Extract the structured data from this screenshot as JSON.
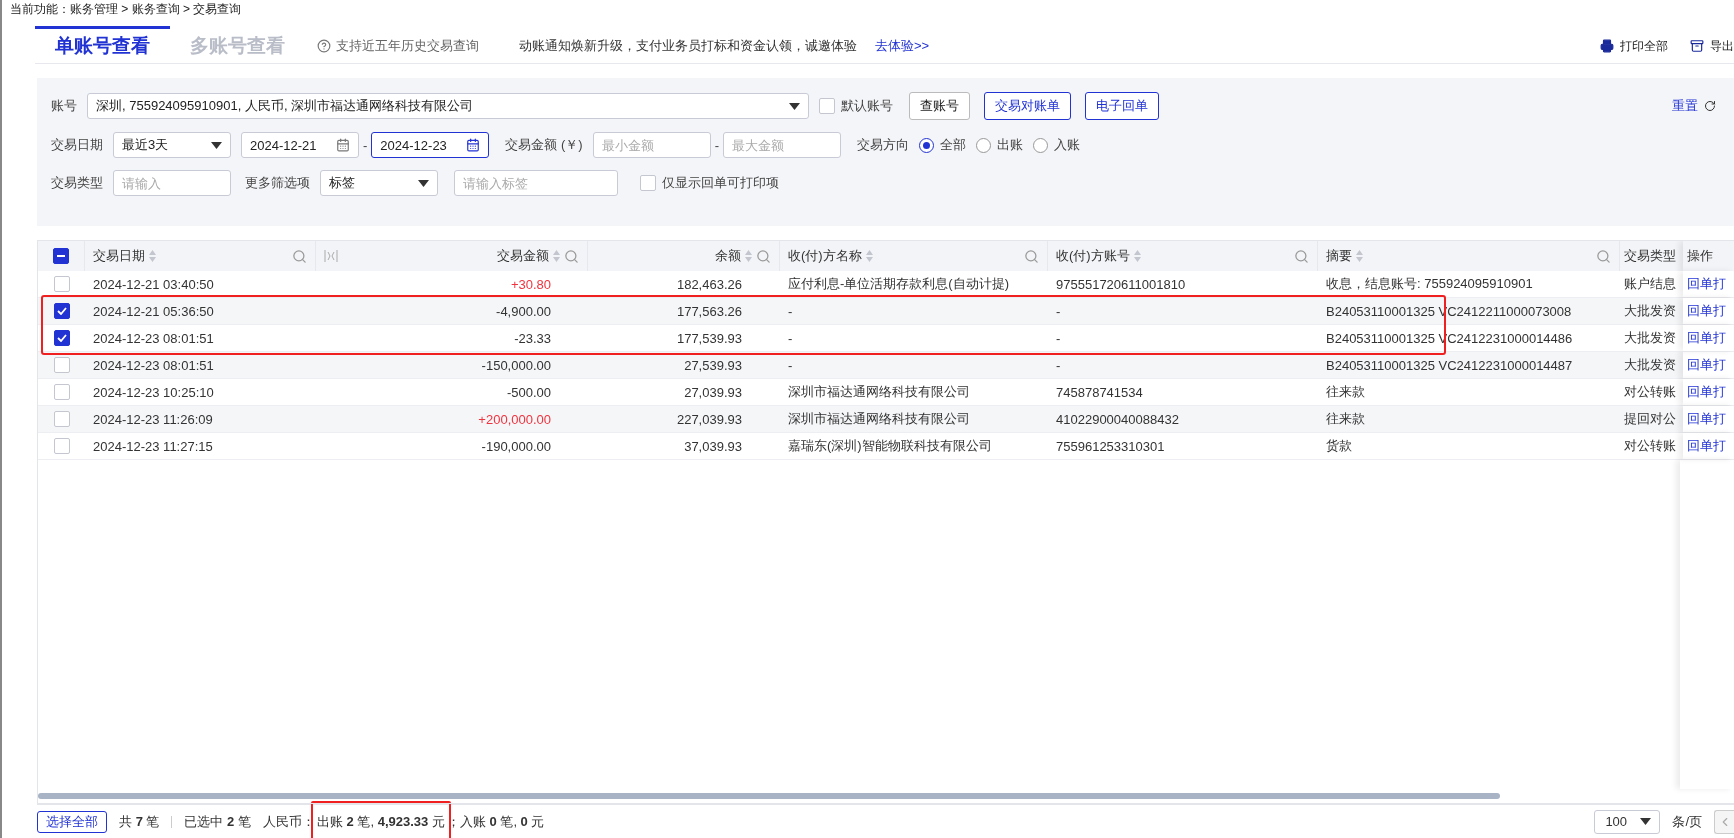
{
  "breadcrumb": "当前功能：账务管理 > 账务查询 > 交易查询",
  "tabs": [
    {
      "label": "单账号查看",
      "selected": true
    },
    {
      "label": "多账号查看",
      "selected": false
    }
  ],
  "tab_hint": "支持近五年历史交易查询",
  "notice": {
    "text": "动账通知焕新升级，支付业务员打标和资金认领，诚邀体验",
    "link": "去体验>>"
  },
  "top_actions": [
    {
      "label": "打印全部",
      "kind": "print"
    },
    {
      "label": "导出",
      "kind": "export"
    }
  ],
  "filters": {
    "account": {
      "label": "账号",
      "value": "深圳, 755924095910901, 人民币, 深圳市福达通网络科技有限公司"
    },
    "default_account": {
      "label": "默认账号",
      "checked": false
    },
    "buttons": [
      {
        "label": "查账号",
        "kind": "plain"
      },
      {
        "label": "交易对账单",
        "kind": "primary"
      },
      {
        "label": "电子回单",
        "kind": "primary"
      }
    ],
    "reset": "重置",
    "date": {
      "label": "交易日期",
      "range": "最近3天",
      "start": "2024-12-21",
      "start_focused": false,
      "separator": "-",
      "end": "2024-12-23",
      "end_focused": true
    },
    "amount": {
      "label": "交易金额 (￥)",
      "min_placeholder": "最小金额",
      "separator": "-",
      "max_placeholder": "最大金额"
    },
    "direction": {
      "label": "交易方向",
      "options": [
        {
          "label": "全部",
          "selected": true
        },
        {
          "label": "出账",
          "selected": false
        },
        {
          "label": "入账",
          "selected": false
        }
      ]
    },
    "type": {
      "label": "交易类型",
      "placeholder": "请输入"
    },
    "more": {
      "label": "更多筛选项",
      "value": "标签",
      "placeholder": "请输入标签"
    },
    "print_only": {
      "label": "仅显示回单可打印项",
      "checked": false
    }
  },
  "table": {
    "header_checked": true,
    "header_indeterminate": true,
    "columns": [
      "交易日期",
      "交易金额",
      "余额",
      "收(付)方名称",
      "收(付)方账号",
      "摘要",
      "交易类型",
      "操作"
    ],
    "rows": [
      {
        "checked": false,
        "highlighted": false,
        "date": "2024-12-21 03:40:50",
        "amount": "+30.80",
        "incoming": true,
        "balance": "182,463.26",
        "name": "应付利息-单位活期存款利息(自动计提)",
        "account": "975551720611001810",
        "summary": "收息，结息账号: 755924095910901",
        "type": "账户结息",
        "action": "回单打"
      },
      {
        "checked": true,
        "highlighted": true,
        "date": "2024-12-21 05:36:50",
        "amount": "-4,900.00",
        "incoming": false,
        "balance": "177,563.26",
        "name": "-",
        "account": "-",
        "summary": "B24053110001325 VC2412211000073008",
        "type": "大批发资",
        "action": "回单打"
      },
      {
        "checked": true,
        "highlighted": true,
        "date": "2024-12-23 08:01:51",
        "amount": "-23.33",
        "incoming": false,
        "balance": "177,539.93",
        "name": "-",
        "account": "-",
        "summary": "B24053110001325 VC2412231000014486",
        "type": "大批发资",
        "action": "回单打"
      },
      {
        "checked": false,
        "highlighted": false,
        "date": "2024-12-23 08:01:51",
        "amount": "-150,000.00",
        "incoming": false,
        "balance": "27,539.93",
        "name": "-",
        "account": "-",
        "summary": "B24053110001325 VC2412231000014487",
        "type": "大批发资",
        "action": "回单打"
      },
      {
        "checked": false,
        "highlighted": false,
        "date": "2024-12-23 10:25:10",
        "amount": "-500.00",
        "incoming": false,
        "balance": "27,039.93",
        "name": "深圳市福达通网络科技有限公司",
        "account": "745878741534",
        "summary": "往来款",
        "type": "对公转账",
        "action": "回单打"
      },
      {
        "checked": false,
        "highlighted": false,
        "date": "2024-12-23 11:26:09",
        "amount": "+200,000.00",
        "incoming": true,
        "balance": "227,039.93",
        "name": "深圳市福达通网络科技有限公司",
        "account": "41022900040088432",
        "summary": "往来款",
        "type": "提回对公",
        "action": "回单打"
      },
      {
        "checked": false,
        "highlighted": false,
        "date": "2024-12-23 11:27:15",
        "amount": "-190,000.00",
        "incoming": false,
        "balance": "37,039.93",
        "name": "嘉瑞东(深圳)智能物联科技有限公司",
        "account": "755961253310301",
        "summary": "货款",
        "type": "对公转账",
        "action": "回单打"
      }
    ]
  },
  "footer": {
    "select_all": "选择全部",
    "total": "共 **7** 笔",
    "selected": "已选中 **2** 笔",
    "currency": "人民币：",
    "outgoing": "出账 **2** 笔, **4,923.33** 元",
    "outgoing_highlighted": true,
    "incoming": "；入账 **0** 笔, **0** 元",
    "page_size": "100",
    "page_unit": "条/页"
  }
}
